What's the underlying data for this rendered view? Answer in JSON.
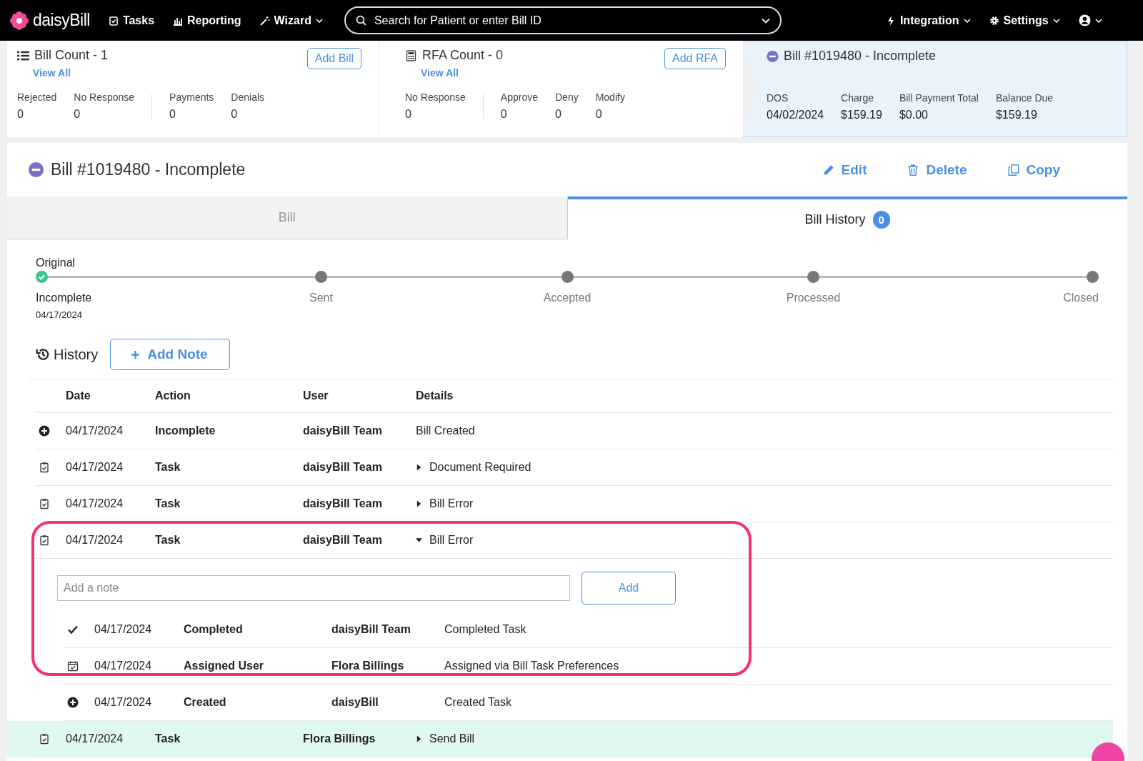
{
  "navbar": {
    "logo": "daisyBill",
    "tasks": "Tasks",
    "reporting": "Reporting",
    "wizard": "Wizard",
    "search": {
      "placeholder": "Search for Patient or enter Bill ID"
    },
    "integration": "Integration",
    "settings": "Settings"
  },
  "summary": {
    "bill_count": {
      "title": "Bill Count - 1",
      "link": "View All",
      "button": "Add Bill",
      "stat_groups": [
        [
          {
            "label": "Rejected",
            "value": "0"
          },
          {
            "label": "No Response",
            "value": "0"
          }
        ],
        [
          {
            "label": "Payments",
            "value": "0"
          },
          {
            "label": "Denials",
            "value": "0"
          }
        ]
      ]
    },
    "rfa_count": {
      "title": "RFA Count - 0",
      "link": "View All",
      "button": "Add RFA",
      "stat_groups": [
        [
          {
            "label": "No Response",
            "value": "0"
          }
        ],
        [
          {
            "label": "Approve",
            "value": "0"
          },
          {
            "label": "Deny",
            "value": "0"
          },
          {
            "label": "Modify",
            "value": "0"
          }
        ]
      ]
    },
    "current_bill": {
      "title": "Bill #1019480 - Incomplete",
      "stats": [
        {
          "label": "DOS",
          "value": "04/02/2024"
        },
        {
          "label": "Charge",
          "value": "$159.19"
        },
        {
          "label": "Bill Payment Total",
          "value": "$0.00"
        },
        {
          "label": "Balance Due",
          "value": "$159.19"
        }
      ]
    }
  },
  "bill": {
    "title": "Bill #1019480 - Incomplete",
    "actions": [
      "Edit",
      "Delete",
      "Copy"
    ]
  },
  "tabs": [
    {
      "label": "Bill",
      "selected": false
    },
    {
      "label": "Bill History",
      "selected": true,
      "badge": "0"
    }
  ],
  "stepper": {
    "caption": "Original",
    "steps": [
      {
        "label": "Incomplete",
        "date": "04/17/2024",
        "done": true
      },
      {
        "label": "Sent",
        "done": false
      },
      {
        "label": "Accepted",
        "done": false
      },
      {
        "label": "Processed",
        "done": false
      },
      {
        "label": "Closed",
        "done": false
      }
    ]
  },
  "history": {
    "title": "History",
    "add_button": "Add Note",
    "columns": [
      "Date",
      "Action",
      "User",
      "Details"
    ],
    "rows": [
      {
        "kind": "created",
        "date": "04/17/2024",
        "action": "Incomplete",
        "user": "daisyBill Team",
        "details": "Bill Created",
        "highlighted": false
      },
      {
        "kind": "task",
        "date": "04/17/2024",
        "action": "Task",
        "user": "daisyBill Team",
        "details": "Document Required",
        "expanded": false,
        "highlighted": false
      },
      {
        "kind": "task",
        "date": "04/17/2024",
        "action": "Task",
        "user": "daisyBill Team",
        "details": "Bill Error",
        "expanded": false,
        "highlighted": false
      },
      {
        "kind": "task",
        "date": "04/17/2024",
        "action": "Task",
        "user": "daisyBill Team",
        "details": "Bill Error",
        "expanded": true,
        "highlighted": false,
        "note": {
          "placeholder": "Add a note",
          "button": "Add"
        },
        "children": [
          {
            "kind": "completed",
            "date": "04/17/2024",
            "action": "Completed",
            "user": "daisyBill Team",
            "details": "Completed Task"
          },
          {
            "kind": "assigned",
            "date": "04/17/2024",
            "action": "Assigned User",
            "user": "Flora Billings",
            "details": "Assigned via Bill Task Preferences"
          },
          {
            "kind": "created",
            "date": "04/17/2024",
            "action": "Created",
            "user": "daisyBill",
            "details": "Created Task"
          }
        ]
      },
      {
        "kind": "task",
        "date": "04/17/2024",
        "action": "Task",
        "user": "Flora Billings",
        "details": "Send Bill",
        "expanded": false,
        "highlighted": true
      }
    ]
  }
}
